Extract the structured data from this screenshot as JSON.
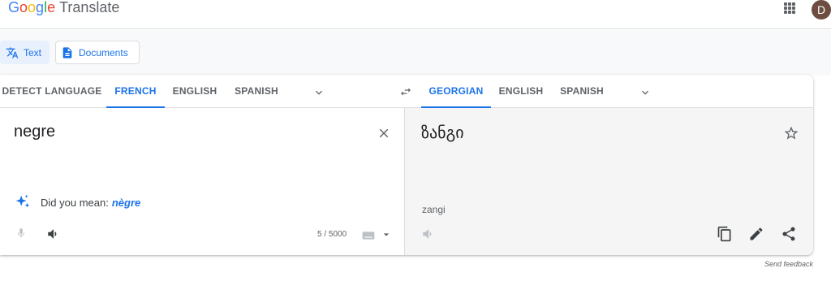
{
  "header": {
    "logo_letters": [
      "G",
      "o",
      "o",
      "g",
      "l",
      "e"
    ],
    "product": "Translate",
    "avatar_initial": "D"
  },
  "modes": [
    {
      "label": "Text",
      "icon": "translate-icon",
      "active": true
    },
    {
      "label": "Documents",
      "icon": "document-icon",
      "active": false
    }
  ],
  "source_langs": [
    "DETECT LANGUAGE",
    "FRENCH",
    "ENGLISH",
    "SPANISH"
  ],
  "source_selected": "FRENCH",
  "target_langs": [
    "GEORGIAN",
    "ENGLISH",
    "SPANISH"
  ],
  "target_selected": "GEORGIAN",
  "source": {
    "text": "negre",
    "did_you_mean_label": "Did you mean:",
    "did_you_mean_value": "nègre",
    "char_count": "5 / 5000"
  },
  "target": {
    "text": "ზანგი",
    "transliteration": "zangi"
  },
  "footer": {
    "send_feedback": "Send feedback"
  },
  "colors": {
    "accent": "#1a73e8",
    "text": "#3c4043",
    "muted": "#5f6368",
    "target_bg": "#f5f5f5"
  }
}
